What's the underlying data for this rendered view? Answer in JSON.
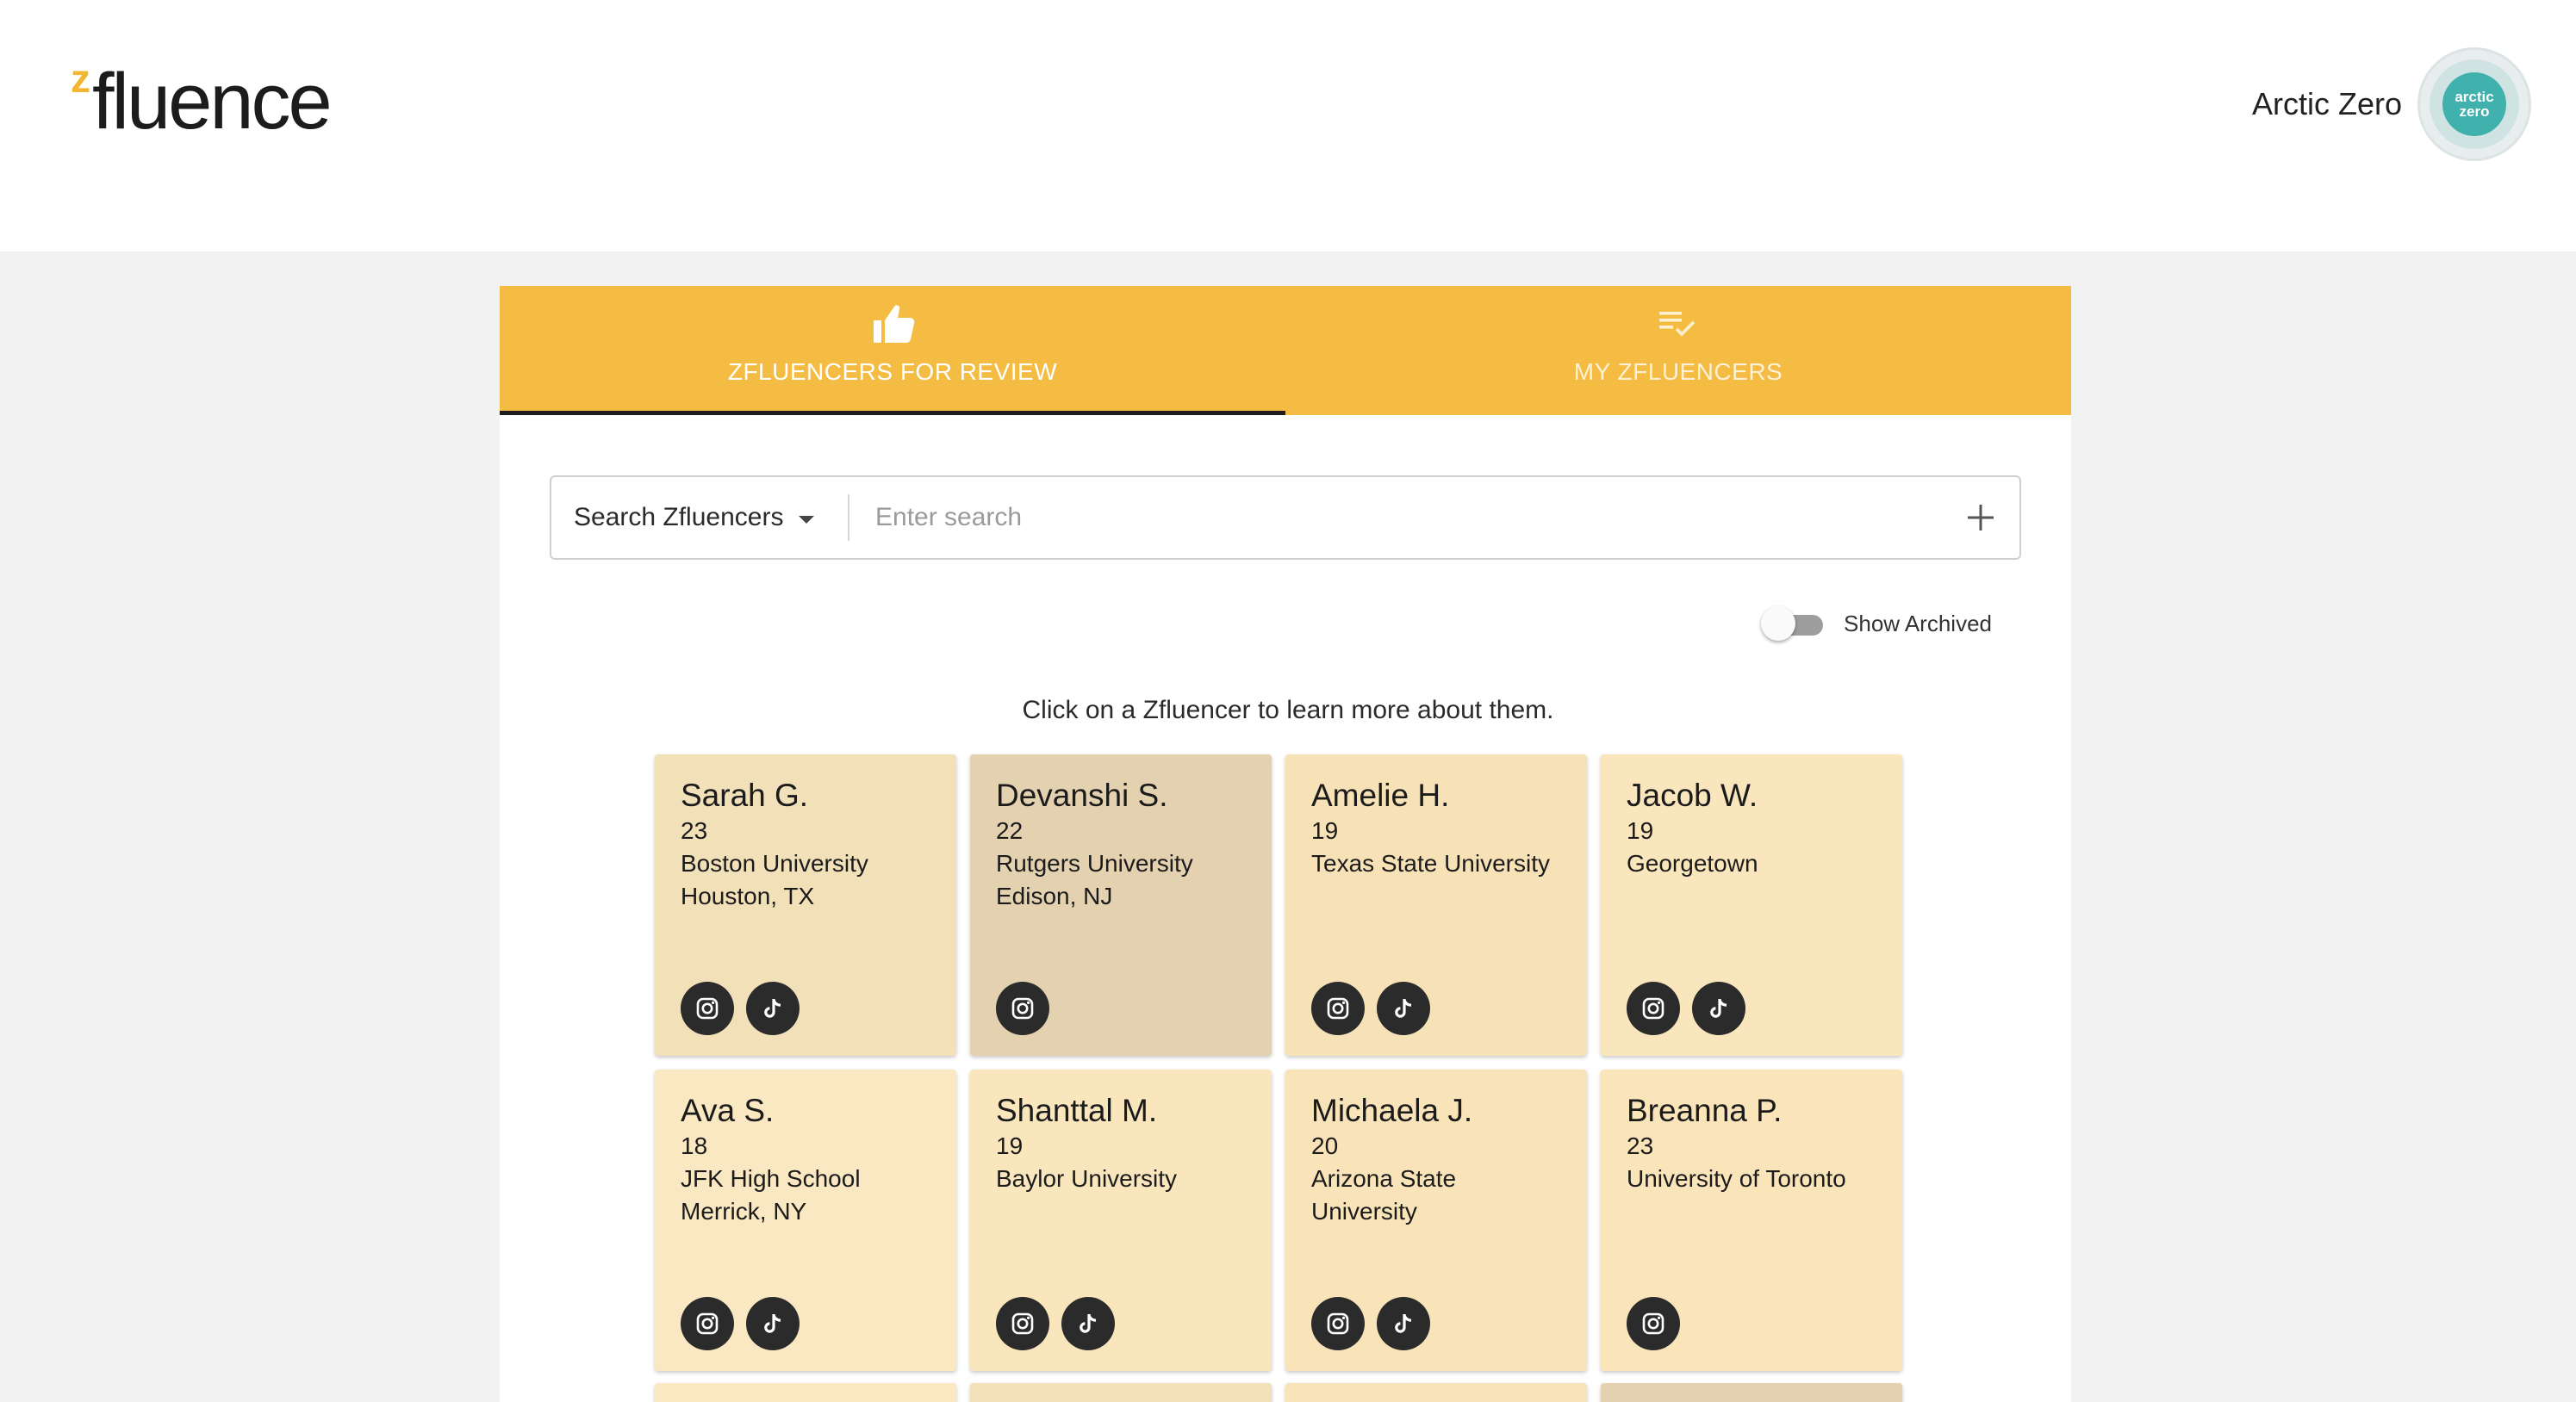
{
  "header": {
    "logo_mark": "z",
    "logo_word": "fluence",
    "account_name": "Arctic Zero",
    "avatar_text_line1": "arctic",
    "avatar_text_line2": "zero"
  },
  "tabs": [
    {
      "label": "ZFLUENCERS FOR REVIEW",
      "icon": "thumbs-up-icon",
      "active": true
    },
    {
      "label": "MY ZFLUENCERS",
      "icon": "checklist-icon",
      "active": false
    }
  ],
  "search": {
    "select_label": "Search Zfluencers",
    "placeholder": "Enter search",
    "value": ""
  },
  "archived_toggle": {
    "label": "Show Archived",
    "on": false
  },
  "instruction": "Click on a Zfluencer to learn more about them.",
  "cards": [
    {
      "name": "Sarah G.",
      "age": "23",
      "line1": "Boston University",
      "line2": "Houston, TX",
      "instagram": true,
      "tiktok": true,
      "bg": "#f2e0b9"
    },
    {
      "name": "Devanshi S.",
      "age": "22",
      "line1": "Rutgers University",
      "line2": "Edison, NJ",
      "instagram": true,
      "tiktok": false,
      "bg": "#e3d1b0"
    },
    {
      "name": "Amelie H.",
      "age": "19",
      "line1": "Texas State University",
      "line2": "",
      "instagram": true,
      "tiktok": true,
      "bg": "#f7e2b8"
    },
    {
      "name": "Jacob W.",
      "age": "19",
      "line1": "Georgetown",
      "line2": "",
      "instagram": true,
      "tiktok": true,
      "bg": "#fae6bd"
    },
    {
      "name": "Ava S.",
      "age": "18",
      "line1": "JFK High School",
      "line2": "Merrick, NY",
      "instagram": true,
      "tiktok": true,
      "bg": "#fae8c2"
    },
    {
      "name": "Shanttal M.",
      "age": "19",
      "line1": "Baylor University",
      "line2": "",
      "instagram": true,
      "tiktok": true,
      "bg": "#fae6bd"
    },
    {
      "name": "Michaela J.",
      "age": "20",
      "line1": "Arizona State",
      "line2": "University",
      "instagram": true,
      "tiktok": true,
      "bg": "#f9e4b9"
    },
    {
      "name": "Breanna P.",
      "age": "23",
      "line1": "University of Toronto",
      "line2": "",
      "instagram": true,
      "tiktok": false,
      "bg": "#fae5ba"
    }
  ],
  "colors": {
    "accent": "#f4bc42",
    "logo_z": "#f2b632",
    "icon_dark": "#2b2b2b",
    "peek_cards": [
      "#fae8c2",
      "#f2e0b9",
      "#f9e4b9",
      "#e3d1b0"
    ]
  }
}
